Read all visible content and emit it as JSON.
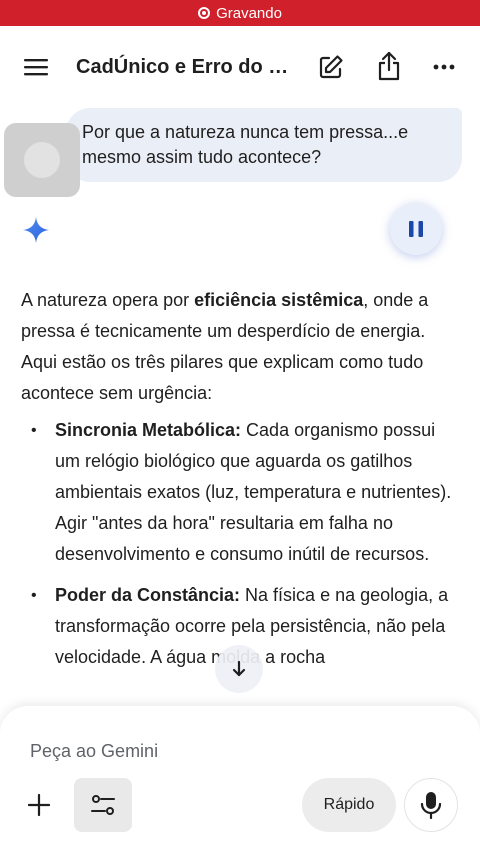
{
  "recording": {
    "label": "Gravando",
    "color": "#d0202b"
  },
  "header": {
    "title": "CadÚnico e Erro do Ch...",
    "icons": [
      "menu-icon",
      "edit-icon",
      "share-icon",
      "more-icon"
    ]
  },
  "user_message": {
    "text": "Por que a natureza nunca tem pressa...e mesmo assim tudo acontece?"
  },
  "response": {
    "intro_before": "A natureza opera por ",
    "intro_bold": "eficiência sistêmica",
    "intro_after": ", onde a pressa é tecnicamente um desperdício de energia. Aqui estão os três pilares que explicam como tudo acontece sem urgência:",
    "bullets": [
      {
        "title": "Sincronia Metabólica:",
        "text": " Cada organismo possui um relógio biológico que aguarda os gatilhos ambientais exatos (luz, temperatura e nutrientes). Agir \"antes da hora\" resultaria em falha no desenvolvimento e consumo inútil de recursos."
      },
      {
        "title": "Poder da Constância:",
        "text": " Na física e na geologia, a transformação ocorre pela persistência, não pela velocidade. A água molda a rocha"
      }
    ]
  },
  "composer": {
    "placeholder": "Peça ao Gemini",
    "model_label": "Rápido"
  },
  "colors": {
    "accent_blue": "#4285f4",
    "bubble_bg": "#eaeef6"
  }
}
